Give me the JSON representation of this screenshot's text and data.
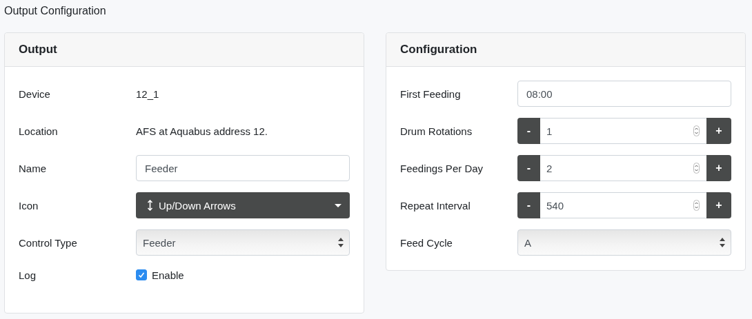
{
  "page_title": "Output Configuration",
  "panels": [
    {
      "title": "Output",
      "rows": [
        {
          "kind": "text",
          "label": "Device",
          "value": "12_1"
        },
        {
          "kind": "text",
          "label": "Location",
          "value": "AFS at Aquabus address 12."
        },
        {
          "kind": "input",
          "label": "Name",
          "value": "Feeder"
        },
        {
          "kind": "dropdown",
          "label": "Icon",
          "value": "Up/Down Arrows"
        },
        {
          "kind": "select",
          "label": "Control Type",
          "value": "Feeder"
        },
        {
          "kind": "checkbox",
          "label": "Log",
          "option": "Enable",
          "checked": true
        }
      ]
    },
    {
      "title": "Configuration",
      "rows": [
        {
          "kind": "input",
          "label": "First Feeding",
          "value": "08:00"
        },
        {
          "kind": "stepper",
          "label": "Drum Rotations",
          "value": "1",
          "minus": "-",
          "plus": "+"
        },
        {
          "kind": "stepper",
          "label": "Feedings Per Day",
          "value": "2",
          "minus": "-",
          "plus": "+"
        },
        {
          "kind": "stepper",
          "label": "Repeat Interval",
          "value": "540",
          "minus": "-",
          "plus": "+"
        },
        {
          "kind": "select",
          "label": "Feed Cycle",
          "value": "A"
        }
      ]
    }
  ]
}
